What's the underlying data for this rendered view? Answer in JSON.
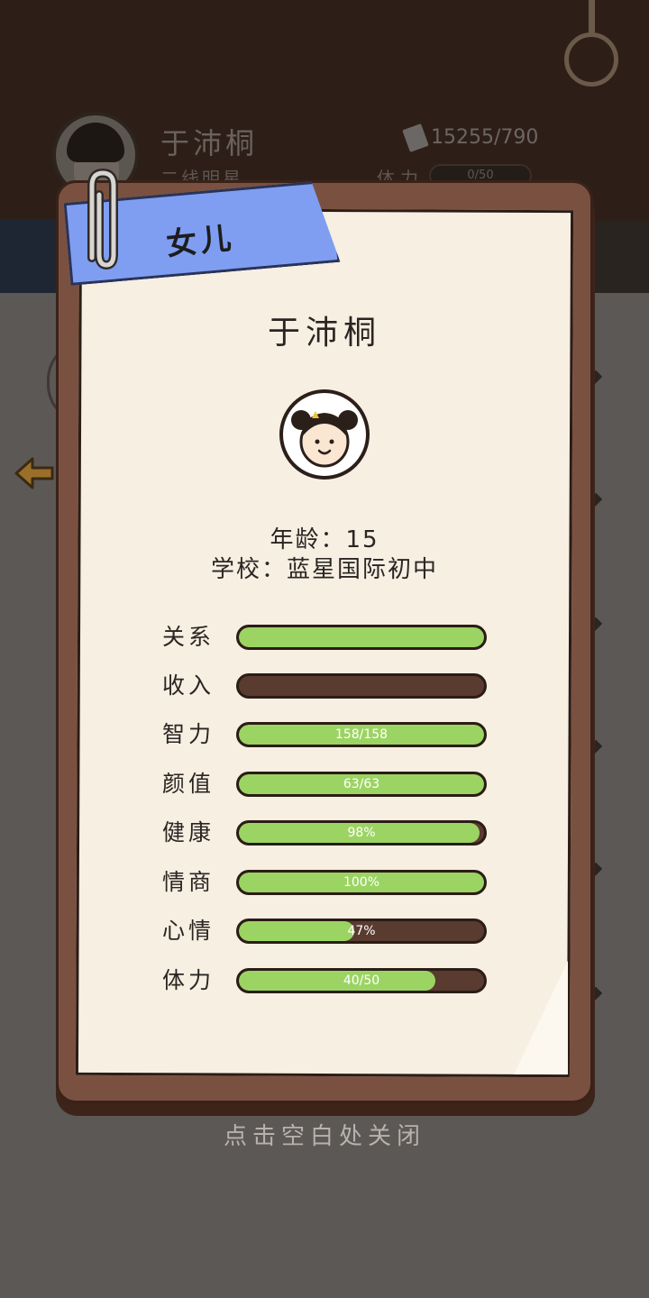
{
  "background": {
    "player_name": "于沛桐",
    "player_rank": "二线明星",
    "money": "15255/790",
    "stamina_label": "体力",
    "stamina_value": "0/50"
  },
  "modal": {
    "ribbon_title": "女儿",
    "name": "于沛桐",
    "age": "年龄：15",
    "school": "学校：蓝星国际初中",
    "stats": [
      {
        "label": "关系",
        "value": "",
        "fill": 1.0
      },
      {
        "label": "收入",
        "value": "",
        "fill": 0.0
      },
      {
        "label": "智力",
        "value": "158/158",
        "fill": 1.0
      },
      {
        "label": "颜值",
        "value": "63/63",
        "fill": 1.0
      },
      {
        "label": "健康",
        "value": "98%",
        "fill": 0.98
      },
      {
        "label": "情商",
        "value": "100%",
        "fill": 1.0
      },
      {
        "label": "心情",
        "value": "47%",
        "fill": 0.47
      },
      {
        "label": "体力",
        "value": "40/50",
        "fill": 0.8
      }
    ]
  },
  "close_hint": "点击空白处关闭",
  "colors": {
    "bar_fill": "#9cd463",
    "bar_empty": "#5a3b30",
    "ribbon": "#7f9ef2",
    "paper": "#f6efe2",
    "card": "#7a5140"
  }
}
